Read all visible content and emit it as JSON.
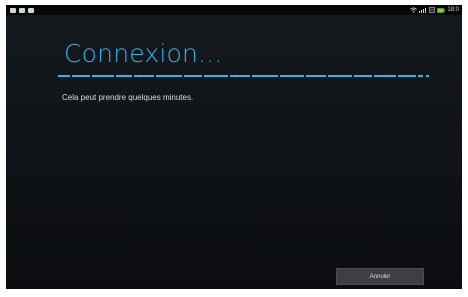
{
  "status_bar": {
    "left_icons": [
      "image-icon",
      "mail-icon",
      "gallery-icon"
    ],
    "right_icons": [
      "wifi-icon",
      "signal-icon",
      "data-icon",
      "battery-icon"
    ],
    "time": "18:0"
  },
  "dialog": {
    "title": "Connexion...",
    "message": "Cela peut prendre quelques minutes.",
    "cancel_label": "Annuler"
  },
  "colors": {
    "accent": "#33b5e5",
    "background": "#101418",
    "button": "#3d3f42",
    "battery": "#7ecf2f"
  }
}
